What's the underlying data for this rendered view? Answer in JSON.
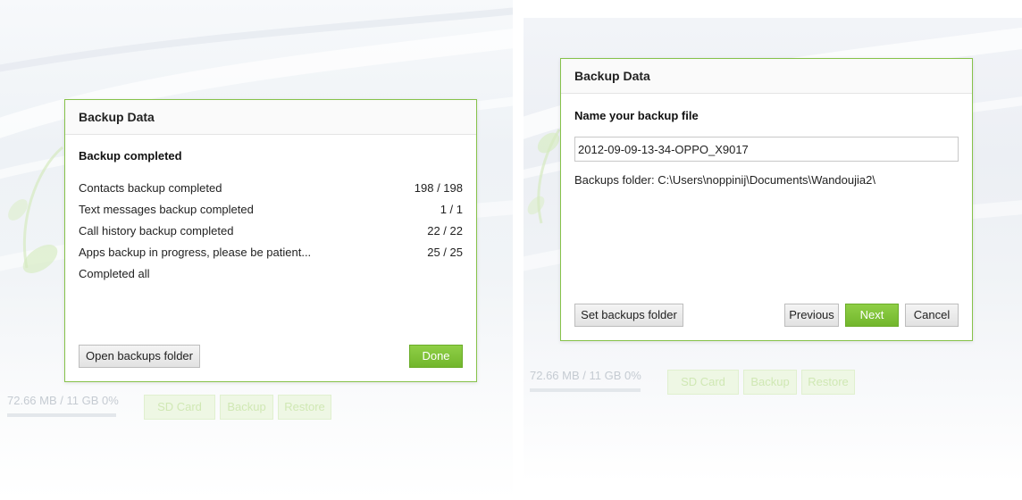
{
  "colors": {
    "accent": "#86c24a",
    "button_primary": "#7ec13a",
    "border": "#86c24a"
  },
  "left": {
    "background": {
      "storage_status": "72.66 MB / 11 GB 0%",
      "storage_progress": 0,
      "tabs": [
        "SD Card",
        "Backup",
        "Restore"
      ]
    },
    "dialog": {
      "title": "Backup Data",
      "subtitle": "Backup completed",
      "items": [
        {
          "label": "Contacts backup completed",
          "count": "198 / 198"
        },
        {
          "label": "Text messages backup completed",
          "count": "1 / 1"
        },
        {
          "label": "Call history backup completed",
          "count": "22 / 22"
        },
        {
          "label": "Apps backup in progress, please be patient...",
          "count": "25 / 25"
        },
        {
          "label": "Completed all",
          "count": ""
        }
      ],
      "open_folder_label": "Open backups folder",
      "done_label": "Done"
    }
  },
  "right": {
    "background": {
      "storage_status": "72.66 MB / 11 GB 0%",
      "storage_progress": 0,
      "tabs": [
        "SD Card",
        "Backup",
        "Restore"
      ]
    },
    "dialog": {
      "title": "Backup Data",
      "subtitle": "Name your backup file",
      "filename_value": "2012-09-09-13-34-OPPO_X9017",
      "folder_info": "Backups folder: C:\\Users\\noppinij\\Documents\\Wandoujia2\\",
      "set_folder_label": "Set backups folder",
      "previous_label": "Previous",
      "next_label": "Next",
      "cancel_label": "Cancel"
    }
  }
}
